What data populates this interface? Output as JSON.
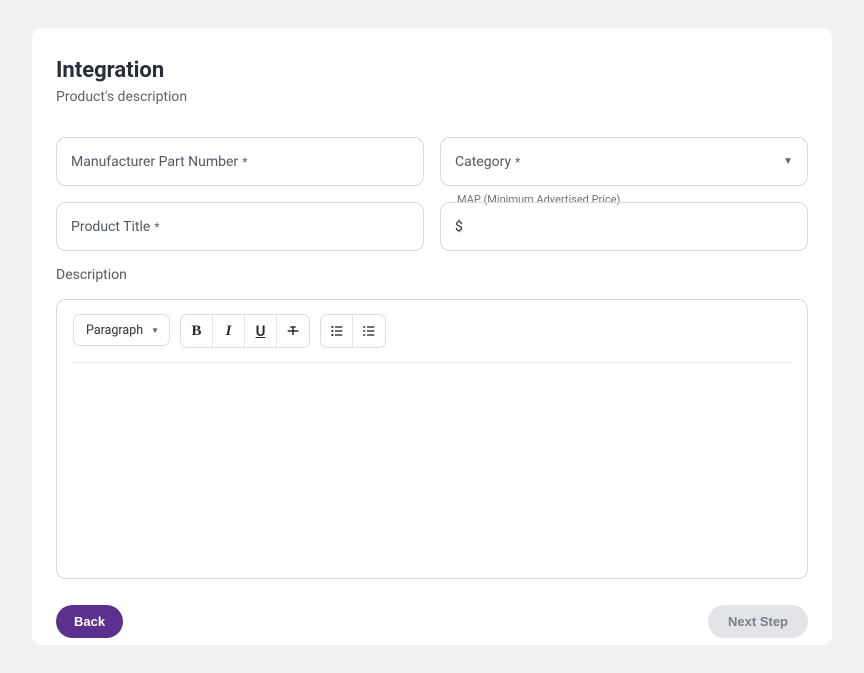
{
  "page": {
    "title": "Integration",
    "subtitle": "Product's description"
  },
  "fields": {
    "mpn": {
      "label": "Manufacturer Part Number",
      "required_mark": "*"
    },
    "category": {
      "label": "Category",
      "required_mark": "*"
    },
    "product_title": {
      "label": "Product Title",
      "required_mark": "*"
    },
    "map_price": {
      "floating_label": "MAP (Minimum Advertised Price)",
      "value": "$"
    }
  },
  "description": {
    "label": "Description"
  },
  "toolbar": {
    "paragraph_label": "Paragraph"
  },
  "buttons": {
    "back": "Back",
    "next": "Next Step"
  }
}
